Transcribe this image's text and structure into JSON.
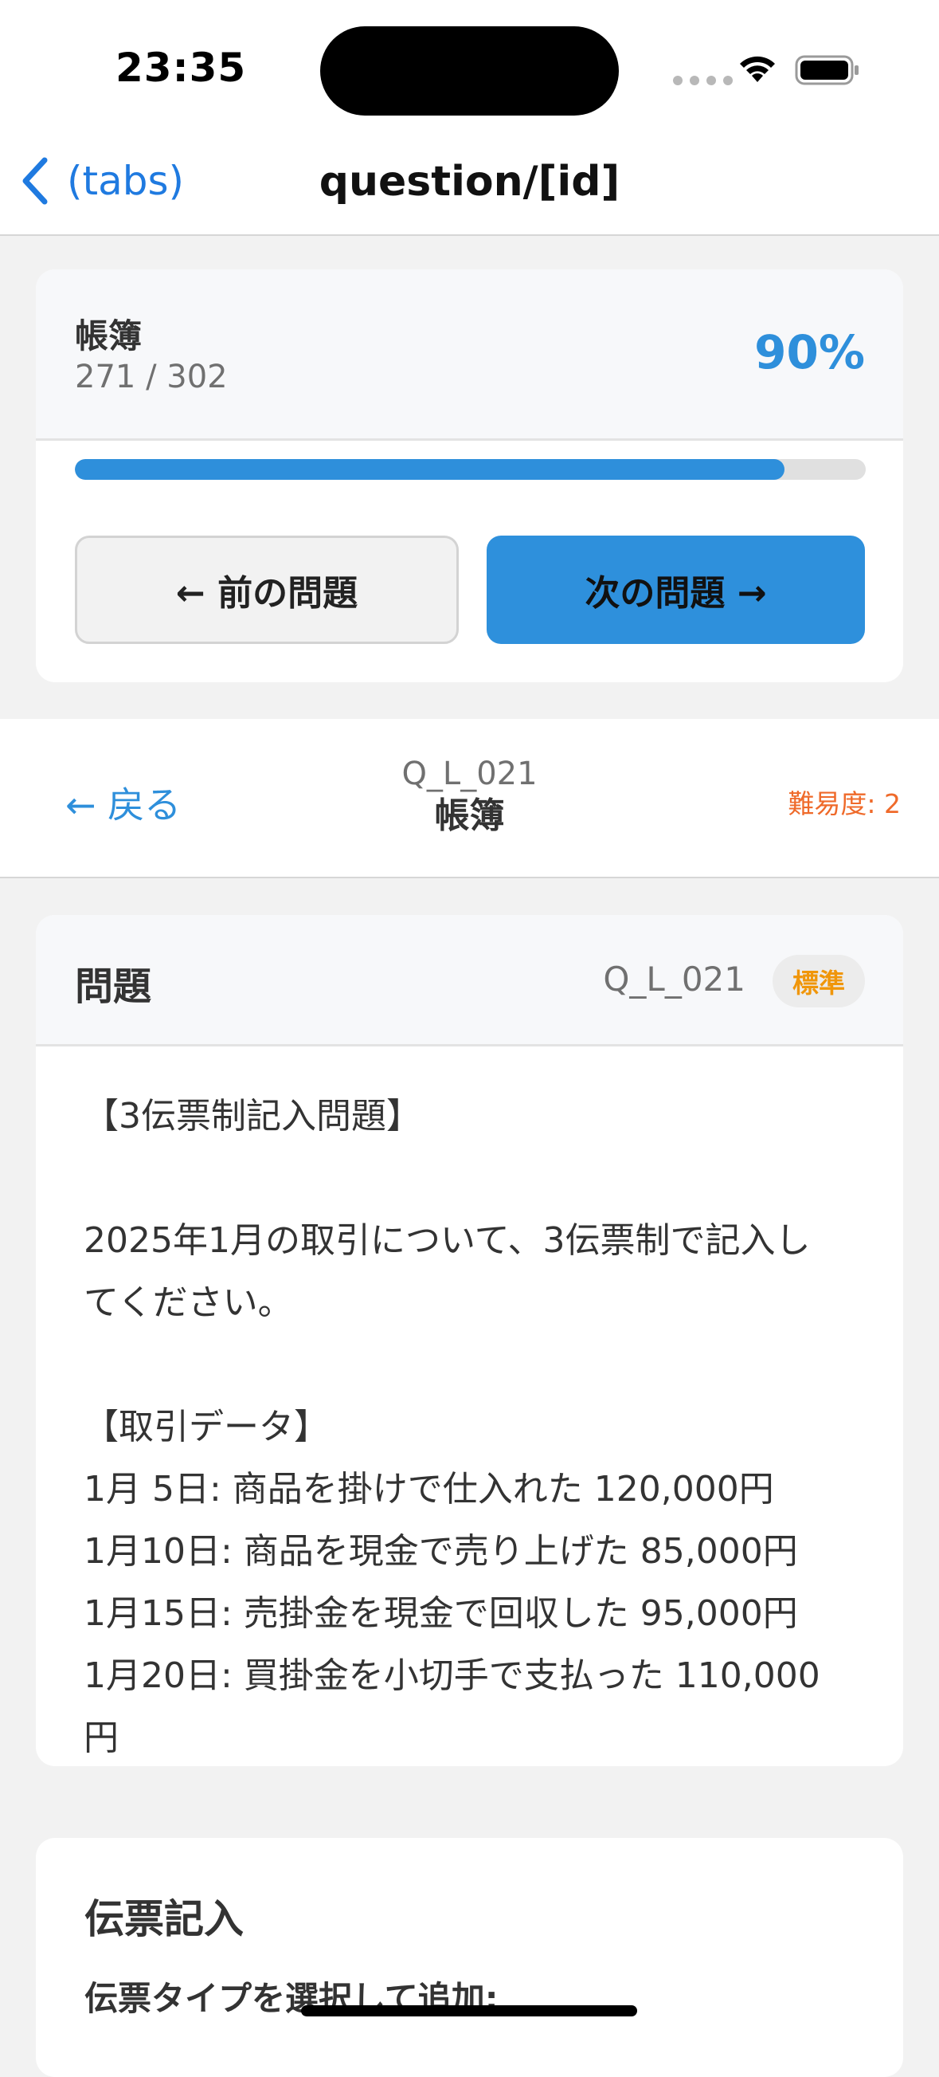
{
  "status_bar": {
    "time": "23:35"
  },
  "nav": {
    "back_label": "(tabs)",
    "title": "question/[id]"
  },
  "progress": {
    "category": "帳簿",
    "count": "271 / 302",
    "percent_label": "90%",
    "fill_fraction": 0.897,
    "prev_button": "← 前の問題",
    "next_button": "次の問題 →"
  },
  "question_header": {
    "back_label": "← 戻る",
    "code": "Q_L_021",
    "category": "帳簿",
    "difficulty": "難易度: 2"
  },
  "problem": {
    "title": "問題",
    "code": "Q_L_021",
    "badge": "標準",
    "lines": [
      "【3伝票制記入問題】",
      "",
      "2025年1月の取引について、3伝票制で記入し",
      "てください。",
      "",
      "【取引データ】",
      "1月 5日: 商品を掛けで仕入れた 120,000円",
      "1月10日: 商品を現金で売り上げた 85,000円",
      "1月15日: 売掛金を現金で回収した 95,000円",
      "1月20日: 買掛金を小切手で支払った 110,000",
      "円"
    ]
  },
  "entry": {
    "title": "伝票記入",
    "subtitle": "伝票タイプを選択して追加:"
  },
  "colors": {
    "accent": "#2e8fdb",
    "difficulty": "#ef6a2a",
    "badge_text": "#f0960a"
  }
}
